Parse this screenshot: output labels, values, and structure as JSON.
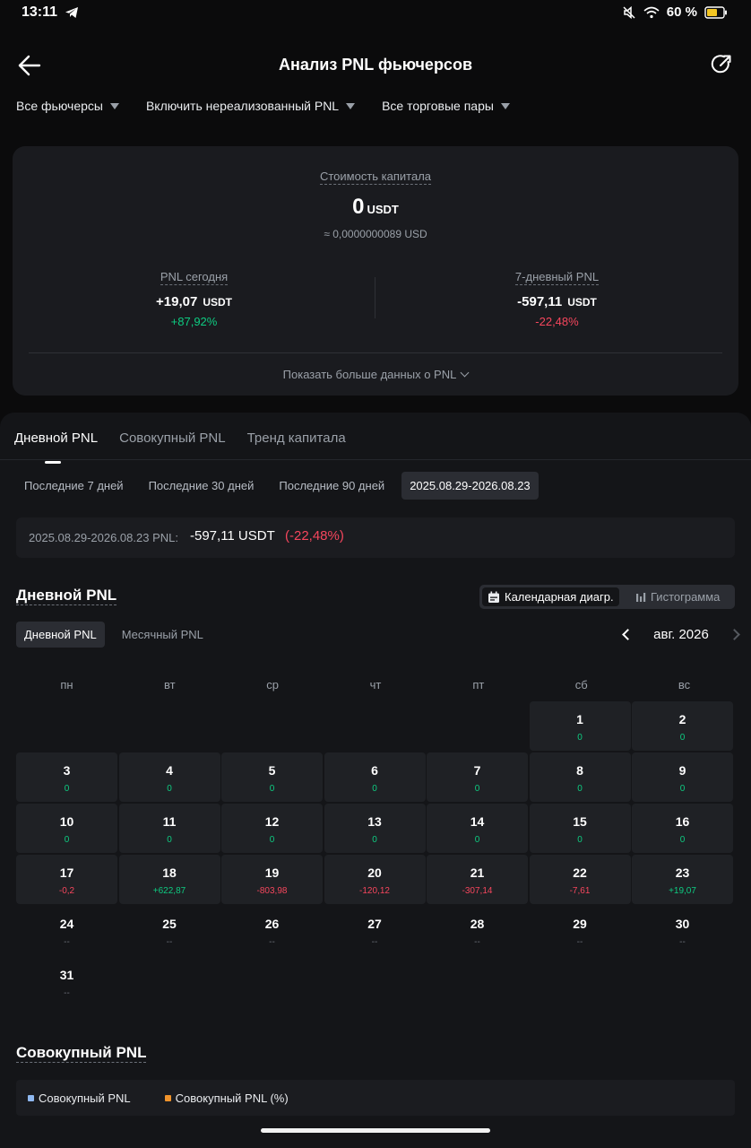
{
  "status": {
    "time": "13:11",
    "battery": "60 %"
  },
  "header": {
    "title": "Анализ PNL фьючерсов"
  },
  "filters": [
    {
      "label": "Все фьючерсы"
    },
    {
      "label": "Включить нереализованный PNL"
    },
    {
      "label": "Все торговые пары"
    }
  ],
  "summary": {
    "capital_label": "Стоимость капитала",
    "capital_value": "0",
    "capital_unit": "USDT",
    "capital_usd": "≈ 0,0000000089 USD",
    "today_label": "PNL сегодня",
    "today_value": "+19,07",
    "today_unit": "USDT",
    "today_pct": "+87,92%",
    "week_label": "7-дневный PNL",
    "week_value": "-597,11",
    "week_unit": "USDT",
    "week_pct": "-22,48%",
    "more_label": "Показать больше данных о PNL"
  },
  "tabs": [
    {
      "label": "Дневной PNL"
    },
    {
      "label": "Совокупный PNL"
    },
    {
      "label": "Тренд капитала"
    }
  ],
  "ranges": [
    {
      "label": "Последние 7 дней"
    },
    {
      "label": "Последние 30 дней"
    },
    {
      "label": "Последние 90 дней"
    },
    {
      "label": "2025.08.29-2026.08.23"
    }
  ],
  "range_pnl": {
    "label": "2025.08.29-2026.08.23 PNL:",
    "value": "-597,11 USDT",
    "pct": "(-22,48%)"
  },
  "daily": {
    "title": "Дневной PNL",
    "view_calendar": "Календарная диагр.",
    "view_histogram": "Гистограмма",
    "subtab_daily": "Дневной PNL",
    "subtab_monthly": "Месячный PNL",
    "month": "авг. 2026",
    "weekdays": [
      "пн",
      "вт",
      "ср",
      "чт",
      "пт",
      "сб",
      "вс"
    ],
    "days": [
      {
        "d": "1",
        "v": "0",
        "s": "pos"
      },
      {
        "d": "2",
        "v": "0",
        "s": "pos"
      },
      {
        "d": "3",
        "v": "0",
        "s": "pos"
      },
      {
        "d": "4",
        "v": "0",
        "s": "pos"
      },
      {
        "d": "5",
        "v": "0",
        "s": "pos"
      },
      {
        "d": "6",
        "v": "0",
        "s": "pos"
      },
      {
        "d": "7",
        "v": "0",
        "s": "pos"
      },
      {
        "d": "8",
        "v": "0",
        "s": "pos"
      },
      {
        "d": "9",
        "v": "0",
        "s": "pos"
      },
      {
        "d": "10",
        "v": "0",
        "s": "pos"
      },
      {
        "d": "11",
        "v": "0",
        "s": "pos"
      },
      {
        "d": "12",
        "v": "0",
        "s": "pos"
      },
      {
        "d": "13",
        "v": "0",
        "s": "pos"
      },
      {
        "d": "14",
        "v": "0",
        "s": "pos"
      },
      {
        "d": "15",
        "v": "0",
        "s": "pos"
      },
      {
        "d": "16",
        "v": "0",
        "s": "pos"
      },
      {
        "d": "17",
        "v": "-0,2",
        "s": "neg"
      },
      {
        "d": "18",
        "v": "+622,87",
        "s": "pos"
      },
      {
        "d": "19",
        "v": "-803,98",
        "s": "neg"
      },
      {
        "d": "20",
        "v": "-120,12",
        "s": "neg"
      },
      {
        "d": "21",
        "v": "-307,14",
        "s": "neg"
      },
      {
        "d": "22",
        "v": "-7,61",
        "s": "neg"
      },
      {
        "d": "23",
        "v": "+19,07",
        "s": "pos"
      },
      {
        "d": "24",
        "v": "--",
        "s": "nil"
      },
      {
        "d": "25",
        "v": "--",
        "s": "nil"
      },
      {
        "d": "26",
        "v": "--",
        "s": "nil"
      },
      {
        "d": "27",
        "v": "--",
        "s": "nil"
      },
      {
        "d": "28",
        "v": "--",
        "s": "nil"
      },
      {
        "d": "29",
        "v": "--",
        "s": "nil"
      },
      {
        "d": "30",
        "v": "--",
        "s": "nil"
      },
      {
        "d": "31",
        "v": "--",
        "s": "nil"
      }
    ]
  },
  "cumulative": {
    "title": "Совокупный PNL",
    "legend_a": "Совокупный PNL",
    "legend_b": "Совокупный PNL (%)",
    "color_a": "#8fb8f0",
    "color_b": "#f0932b"
  },
  "colors": {
    "positive": "#0ecb81",
    "negative": "#f6465d"
  }
}
